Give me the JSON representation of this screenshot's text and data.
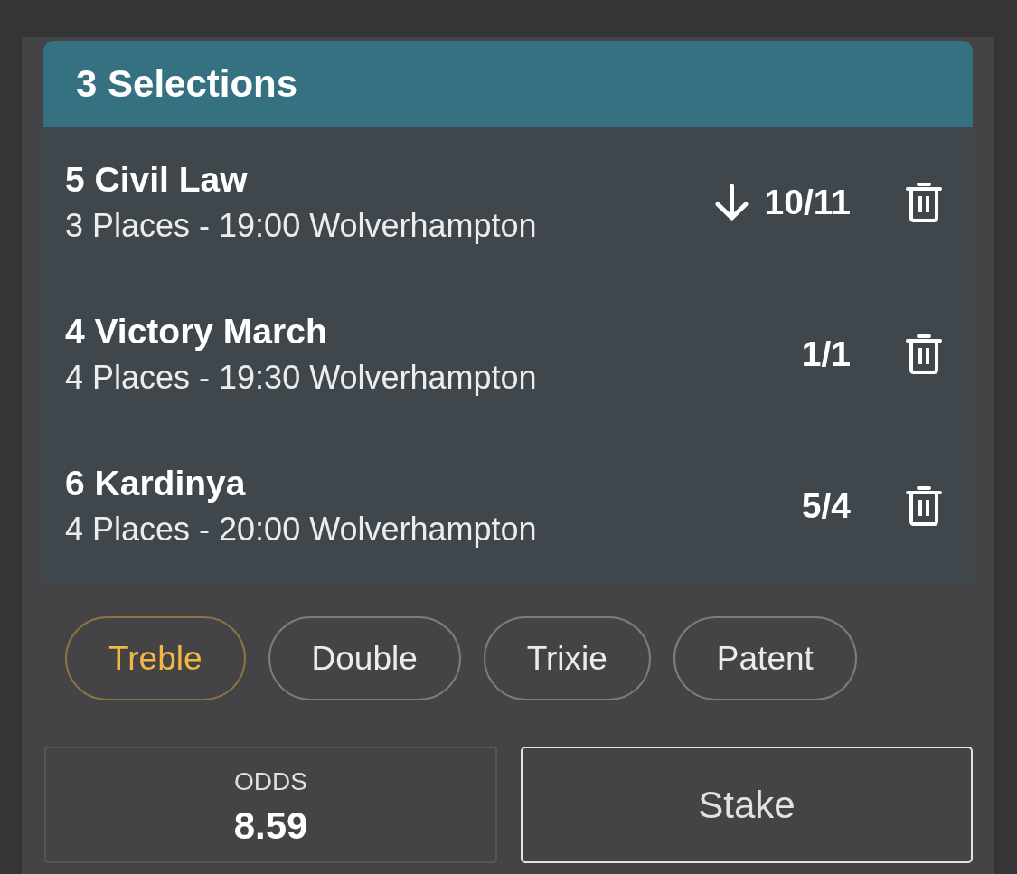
{
  "header": {
    "title": "3 Selections"
  },
  "selections": [
    {
      "name": "5 Civil Law",
      "details": "3 Places - 19:00 Wolverhampton",
      "odds": "10/11",
      "price_down": true
    },
    {
      "name": "4 Victory March",
      "details": "4 Places - 19:30 Wolverhampton",
      "odds": "1/1",
      "price_down": false
    },
    {
      "name": "6 Kardinya",
      "details": "4 Places - 20:00 Wolverhampton",
      "odds": "5/4",
      "price_down": false
    }
  ],
  "bet_types": [
    {
      "label": "Treble",
      "selected": true
    },
    {
      "label": "Double",
      "selected": false
    },
    {
      "label": "Trixie",
      "selected": false
    },
    {
      "label": "Patent",
      "selected": false
    }
  ],
  "odds_box": {
    "label": "ODDS",
    "value": "8.59"
  },
  "stake_field": {
    "placeholder": "Stake"
  }
}
